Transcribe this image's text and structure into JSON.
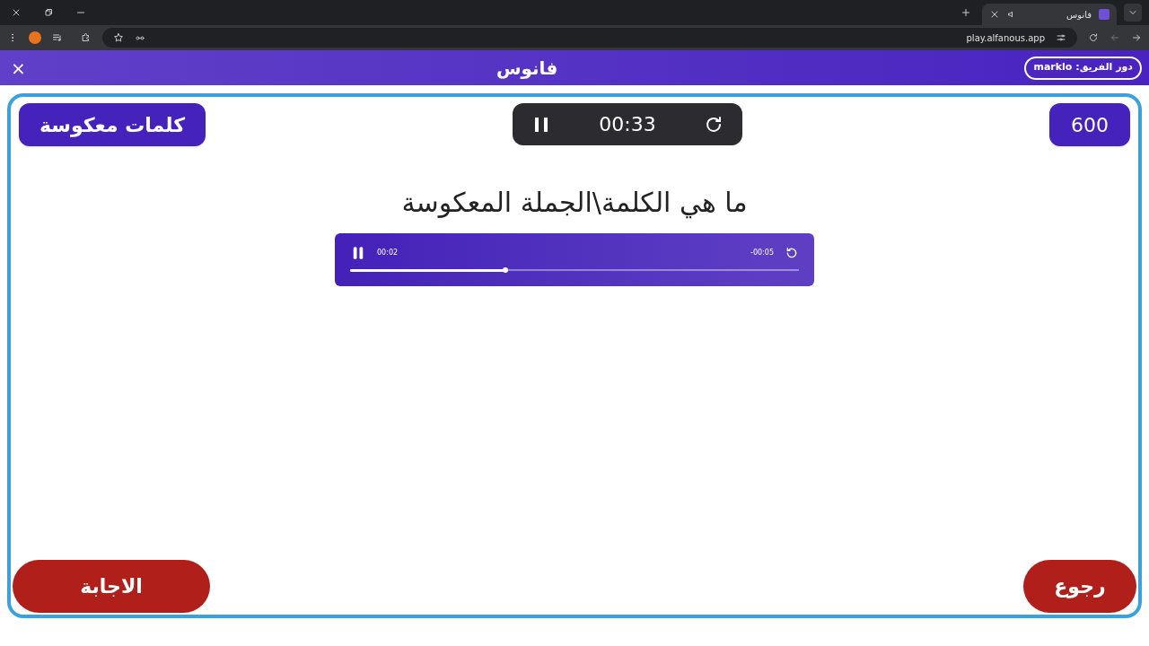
{
  "browser": {
    "tab_title": "فانوس",
    "url": "play.alfanous.app"
  },
  "header": {
    "logo": "فانوس",
    "team_turn": "دور الفريق: marklo",
    "close": "×"
  },
  "game": {
    "category": "كلمات معكوسة",
    "timer": "00:33",
    "points": "600",
    "question": "ما هي الكلمة\\الجملة المعكوسة",
    "audio": {
      "elapsed": "00:02",
      "remaining": "-00:05",
      "playing": true,
      "level": 0.345
    },
    "answer_button": "الاجابة",
    "back_button": "رجوع"
  }
}
